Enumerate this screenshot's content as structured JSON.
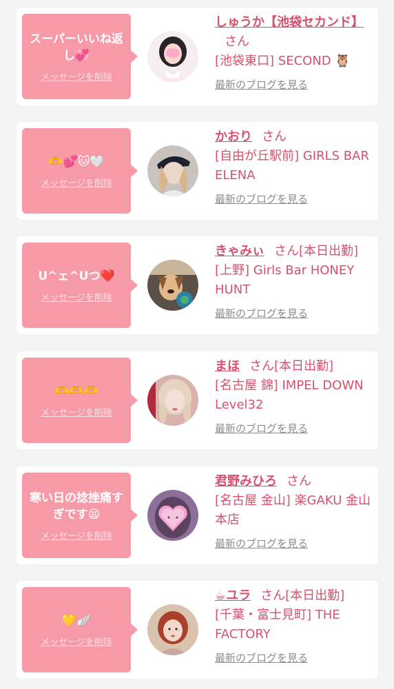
{
  "common": {
    "delete_label": "メッセージを削除",
    "blog_label": "最新のブログを見る",
    "san": "さん"
  },
  "items": [
    {
      "message": "スーパーいいね返し💞",
      "name": "しゅうか【池袋セカンド】",
      "status": "",
      "shop": "[池袋東口] SECOND 🦉",
      "avatar_icon": "avatar-pink-icon"
    },
    {
      "message": "🫶💕🐱🤍",
      "name": "かおり",
      "status": "",
      "shop": "[自由が丘駅前] GIRLS BAR ELENA",
      "avatar_icon": "avatar-cap-icon"
    },
    {
      "message": "U^ェ^Uつ❤️",
      "name": "きゃみぃ",
      "status": "[本日出勤]",
      "shop": "[上野] Girls Bar HONEY HUNT",
      "avatar_icon": "avatar-dog-filter-icon"
    },
    {
      "message": "🫶🫶🫶",
      "name": "まほ",
      "status": "[本日出勤]",
      "shop": "[名古屋 錦] IMPEL DOWN Level32",
      "avatar_icon": "avatar-blonde-icon"
    },
    {
      "message": "寒い日の捻挫痛すぎです😫",
      "name": "君野みひろ",
      "status": "",
      "shop": "[名古屋 金山] 楽GAKU 金山本店",
      "avatar_icon": "avatar-heart-icon"
    },
    {
      "message": "💛🪽",
      "name": "☕ユラ",
      "status": "[本日出勤]",
      "shop": "[千葉・富士見町] THE FACTORY",
      "avatar_icon": "avatar-redhair-icon"
    }
  ]
}
